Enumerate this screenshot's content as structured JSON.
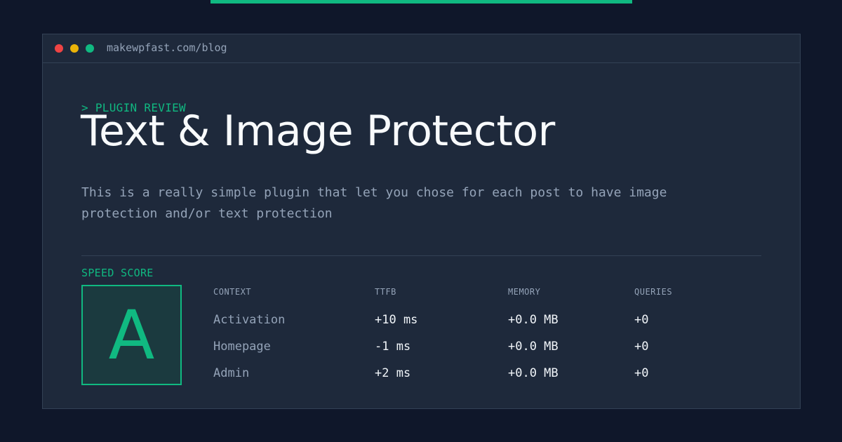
{
  "window": {
    "url": "makewpfast.com/blog"
  },
  "post": {
    "kicker": "> PLUGIN REVIEW",
    "title": "Text & Image Protector",
    "description": "This is a really simple plugin that let you chose for each post to have image protection and/or text protection"
  },
  "speed": {
    "label": "SPEED SCORE",
    "grade": "A"
  },
  "table": {
    "headers": [
      "CONTEXT",
      "TTFB",
      "MEMORY",
      "QUERIES"
    ],
    "rows": [
      {
        "context": "Activation",
        "ttfb": "+10 ms",
        "memory": "+0.0 MB",
        "queries": "+0"
      },
      {
        "context": "Homepage",
        "ttfb": "-1 ms",
        "memory": "+0.0 MB",
        "queries": "+0"
      },
      {
        "context": "Admin",
        "ttfb": "+2 ms",
        "memory": "+0.0 MB",
        "queries": "+0"
      }
    ]
  },
  "colors": {
    "accent": "#10b981",
    "background": "#0f172a",
    "card": "#1e293b"
  }
}
